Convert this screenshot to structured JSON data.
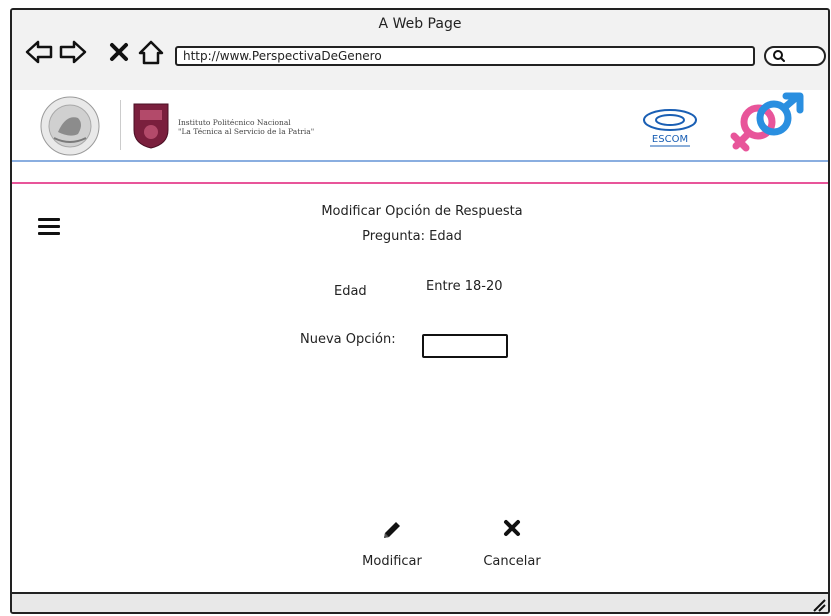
{
  "window": {
    "title": "A Web Page"
  },
  "browser": {
    "url": "http://www.PerspectivaDeGenero",
    "icons": [
      "back-arrow-icon",
      "forward-arrow-icon",
      "close-icon",
      "home-icon",
      "search-icon"
    ]
  },
  "header": {
    "institution_line1": "Instituto Politécnico Nacional",
    "institution_line2": "\"La Técnica al Servicio de la Patria\"",
    "escom_label": "ESCOM",
    "colors": {
      "blue_rule": "#8aaee0",
      "pink_rule": "#e8559a",
      "female": "#e8559a",
      "male": "#2a8fe0"
    }
  },
  "page": {
    "title": "Modificar Opción de Respuesta",
    "subtitle": "Pregunta: Edad",
    "field_label": "Edad",
    "field_value": "Entre 18-20",
    "new_option_label": "Nueva Opción:",
    "new_option_value": ""
  },
  "actions": {
    "modify_label": "Modificar",
    "cancel_label": "Cancelar"
  }
}
